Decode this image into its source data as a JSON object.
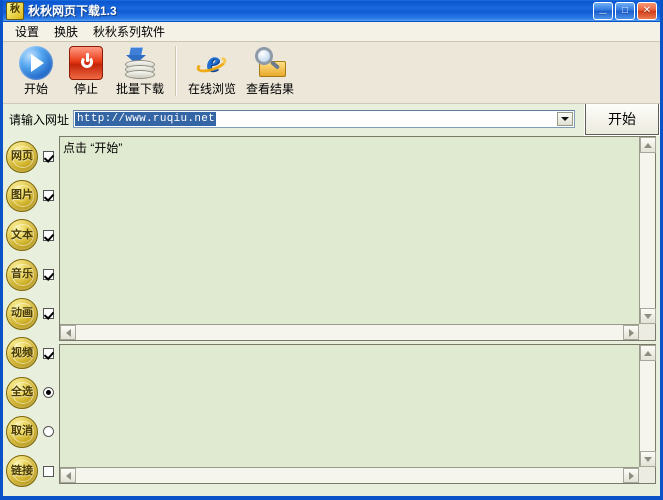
{
  "window": {
    "title": "秋秋网页下载1.3",
    "icon": "app-icon",
    "controls": {
      "minimize": "_",
      "maximize": "□",
      "close": "✕"
    }
  },
  "menu": {
    "items": [
      {
        "label": "设置"
      },
      {
        "label": "换肤"
      },
      {
        "label": "秋秋系列软件"
      }
    ]
  },
  "toolbar": {
    "buttons": [
      {
        "label": "开始",
        "icon": "play-icon"
      },
      {
        "label": "停止",
        "icon": "stop-icon"
      },
      {
        "label": "批量下载",
        "icon": "batch-download-icon"
      },
      {
        "label": "在线浏览",
        "icon": "internet-explorer-icon"
      },
      {
        "label": "查看结果",
        "icon": "magnifier-folder-icon"
      }
    ]
  },
  "url_row": {
    "label": "请输入网址",
    "value": "http://www.ruqiu.net",
    "placeholder": "http://",
    "dropdown_icon": "chevron-down-icon",
    "start_button": "开始"
  },
  "sidebar": {
    "items": [
      {
        "label": "网页",
        "control": "checkbox",
        "checked": true
      },
      {
        "label": "图片",
        "control": "checkbox",
        "checked": true
      },
      {
        "label": "文本",
        "control": "checkbox",
        "checked": true
      },
      {
        "label": "音乐",
        "control": "checkbox",
        "checked": true
      },
      {
        "label": "动画",
        "control": "checkbox",
        "checked": true
      },
      {
        "label": "视频",
        "control": "checkbox",
        "checked": true
      },
      {
        "label": "全选",
        "control": "radio",
        "checked": true
      },
      {
        "label": "取消",
        "control": "radio",
        "checked": false
      },
      {
        "label": "链接",
        "control": "checkbox",
        "checked": false
      }
    ]
  },
  "main": {
    "top_panel": {
      "text": "点击 “开始”"
    },
    "bottom_panel": {
      "text": ""
    }
  },
  "colors": {
    "titlebar": "#0a56d0",
    "toolbar_bg": "#ece7d9",
    "panel_bg": "#dfead0",
    "app_bg": "#e8f0dd",
    "selection": "#3465a4",
    "coin": "#c6a61c"
  }
}
